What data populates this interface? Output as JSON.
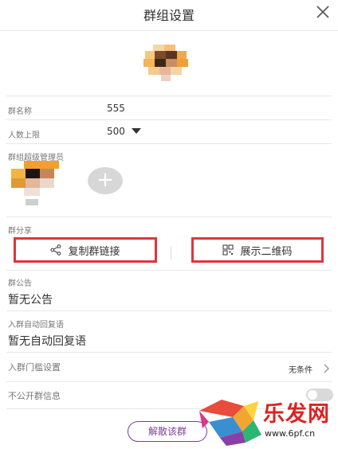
{
  "header": {
    "title": "群组设置"
  },
  "group_name": {
    "label": "群名称",
    "value": "555"
  },
  "member_limit": {
    "label": "人数上限",
    "value": "500"
  },
  "admins": {
    "label": "群组超级管理员"
  },
  "share": {
    "label": "群分享",
    "copy_link": "复制群链接",
    "show_qr": "展示二维码"
  },
  "announcement": {
    "label": "群公告",
    "value": "暂无公告"
  },
  "auto_reply": {
    "label": "入群自动回复语",
    "value": "暂无自动回复语"
  },
  "entry_threshold": {
    "label": "入群门槛设置",
    "value": "无条件"
  },
  "private_info": {
    "label": "不公开群信息",
    "enabled": false
  },
  "dissolve": {
    "label": "解散该群"
  },
  "watermark": {
    "brand": "乐发网",
    "url": "www.6pf.cn"
  },
  "colors": {
    "accent_red": "#e0343b",
    "purple": "#7a3f95",
    "divider": "#e8e8e8"
  }
}
